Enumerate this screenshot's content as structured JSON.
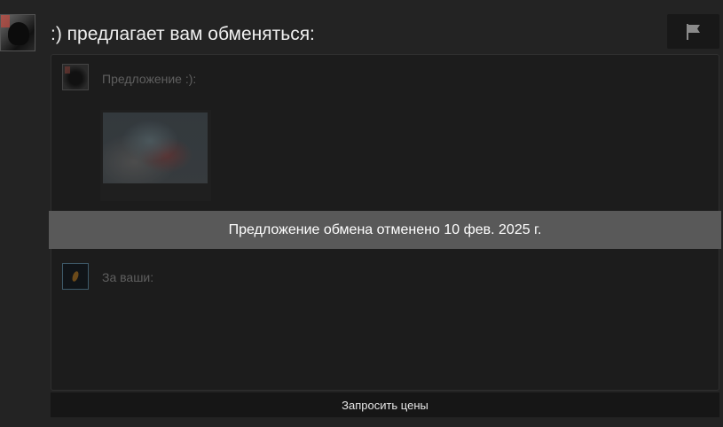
{
  "offer": {
    "headline": ":) предлагает вам обменяться:",
    "offer_label": "Предложение :):",
    "for_yours_label": "За ваши:",
    "status_banner": "Предложение обмена отменено 10 фев. 2025 г.",
    "request_prices_label": "Запросить цены",
    "report_icon": "flag-icon"
  },
  "colors": {
    "background": "#232323",
    "panel": "#1c1c1c",
    "banner": "#595959"
  }
}
